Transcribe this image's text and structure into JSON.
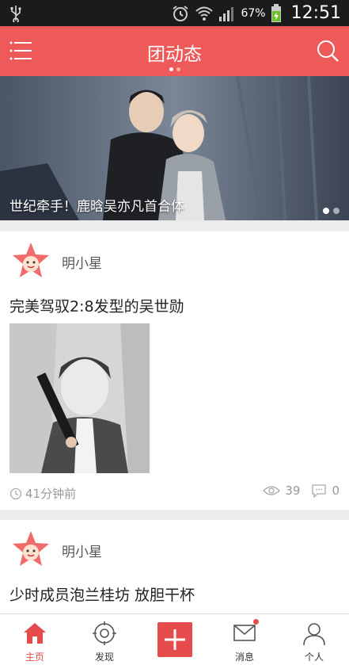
{
  "status_bar": {
    "battery_percent": "67%",
    "time": "12:51"
  },
  "header": {
    "title": "团动态"
  },
  "banner": {
    "caption": "世纪牵手！鹿晗吴亦凡首合体"
  },
  "posts": [
    {
      "author": "明小星",
      "title": "完美驾驭2:8发型的吴世勋",
      "time": "41分钟前",
      "views": "39",
      "comments": "0"
    },
    {
      "author": "明小星",
      "title": "少时成员泡兰桂坊 放胆干杯"
    }
  ],
  "tabs": [
    {
      "label": "主页"
    },
    {
      "label": "发现"
    },
    {
      "label": "消息"
    },
    {
      "label": "个人"
    }
  ],
  "colors": {
    "accent": "#ee5a5a",
    "tab_active": "#e74c4c"
  }
}
